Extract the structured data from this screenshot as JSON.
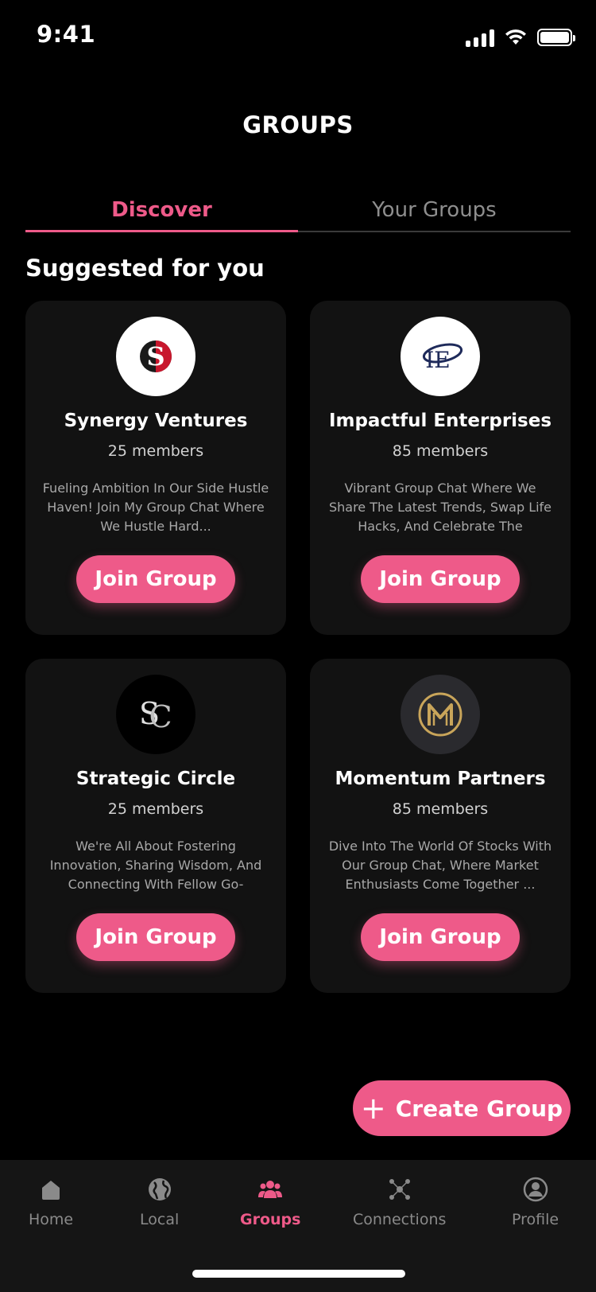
{
  "status_bar": {
    "time": "9:41"
  },
  "header": {
    "title": "GROUPS"
  },
  "tabs": [
    {
      "label": "Discover",
      "active": true
    },
    {
      "label": "Your Groups",
      "active": false
    }
  ],
  "section_title": "Suggested for you",
  "groups": [
    {
      "name": "Synergy Ventures",
      "members": "25 members",
      "description": "Fueling Ambition In Our Side Hustle Haven! Join My Group Chat Where We Hustle Hard...",
      "join_label": "Join Group",
      "logo_text": "S"
    },
    {
      "name": "Impactful Enterprises",
      "members": "85 members",
      "description": "Vibrant Group Chat Where We Share The Latest Trends, Swap Life Hacks, And Celebrate The Diverse...",
      "join_label": "Join Group",
      "logo_text": "IE"
    },
    {
      "name": "Strategic Circle",
      "members": "25 members",
      "description": "We're All About Fostering Innovation, Sharing Wisdom, And Connecting With Fellow Go-Getters...",
      "join_label": "Join Group",
      "logo_text": "SC"
    },
    {
      "name": "Momentum Partners",
      "members": "85 members",
      "description": "Dive Into The World Of Stocks With Our Group Chat, Where Market Enthusiasts Come Together ...",
      "join_label": "Join Group",
      "logo_text": "M"
    }
  ],
  "create_button": {
    "label": "Create Group"
  },
  "bottom_nav": [
    {
      "label": "Home",
      "icon": "home-icon",
      "active": false
    },
    {
      "label": "Local",
      "icon": "globe-icon",
      "active": false
    },
    {
      "label": "Groups",
      "icon": "groups-icon",
      "active": true
    },
    {
      "label": "Connections",
      "icon": "connections-icon",
      "active": false
    },
    {
      "label": "Profile",
      "icon": "profile-icon",
      "active": false
    }
  ],
  "colors": {
    "accent": "#ee5a89",
    "background": "#000000",
    "card": "#121212",
    "nav": "#151515"
  }
}
